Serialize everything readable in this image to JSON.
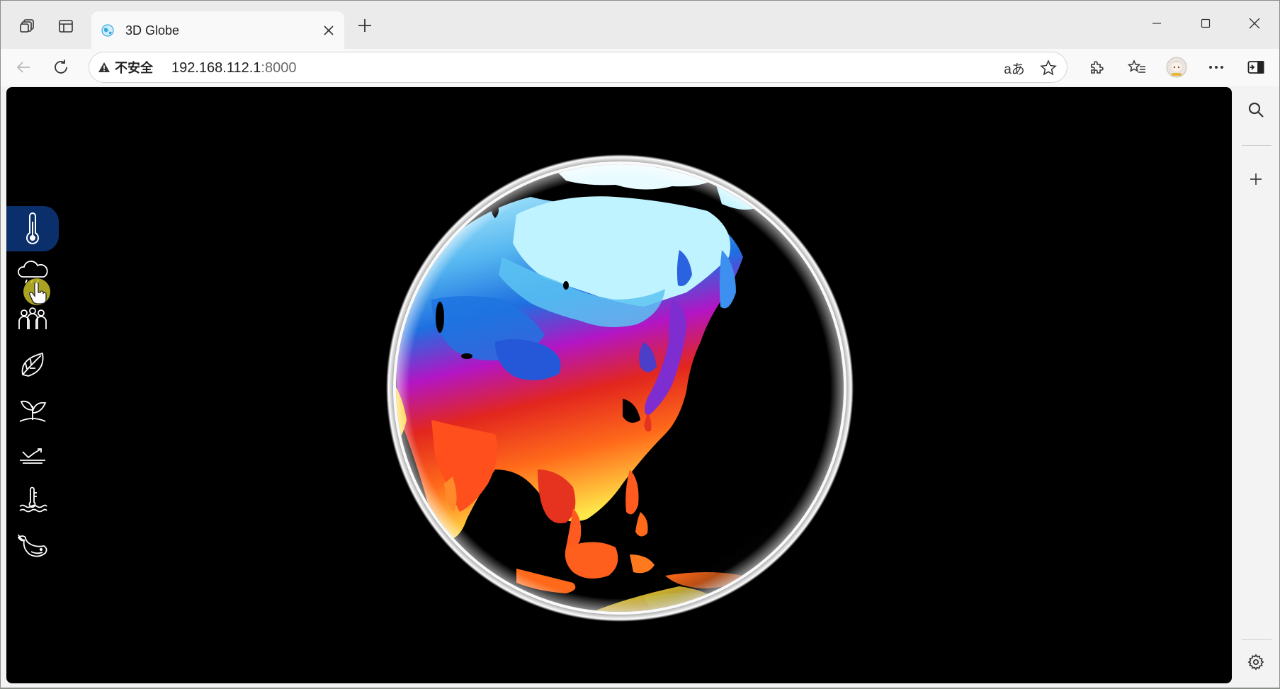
{
  "browser": {
    "tab": {
      "title": "3D Globe",
      "favicon": "globe-favicon"
    },
    "address": {
      "security_label": "不安全",
      "host": "192.168.112.1",
      "port": ":8000"
    },
    "icons": {
      "workspaces": "workspaces-icon",
      "tab_actions": "vertical-tabs-icon",
      "translate": "aあ",
      "favorite": "star-icon",
      "extensions": "puzzle-icon",
      "favorites": "favorites-list-icon",
      "profile": "profile-avatar",
      "more": "more-icon",
      "sidebar_toggle": "sidebar-icon"
    }
  },
  "app": {
    "menu": [
      {
        "id": "temperature",
        "icon": "thermometer-icon",
        "active": true
      },
      {
        "id": "weather",
        "icon": "cloud-rain-icon",
        "active": false
      },
      {
        "id": "population",
        "icon": "people-icon",
        "active": false
      },
      {
        "id": "vegetation",
        "icon": "leaf-icon",
        "active": false
      },
      {
        "id": "agriculture",
        "icon": "sprout-icon",
        "active": false
      },
      {
        "id": "trend",
        "icon": "trend-line-icon",
        "active": false
      },
      {
        "id": "sea-temperature",
        "icon": "water-thermometer-icon",
        "active": false
      },
      {
        "id": "marine-life",
        "icon": "whale-icon",
        "active": false
      }
    ],
    "colors": {
      "active_menu": "#0b2f6b",
      "globe_glow": "#ffffff",
      "cold": "#bff3ff",
      "cool": "#1e7de8",
      "mid": "#b315c4",
      "warm": "#e2261e",
      "hot": "#ffe94a"
    }
  }
}
